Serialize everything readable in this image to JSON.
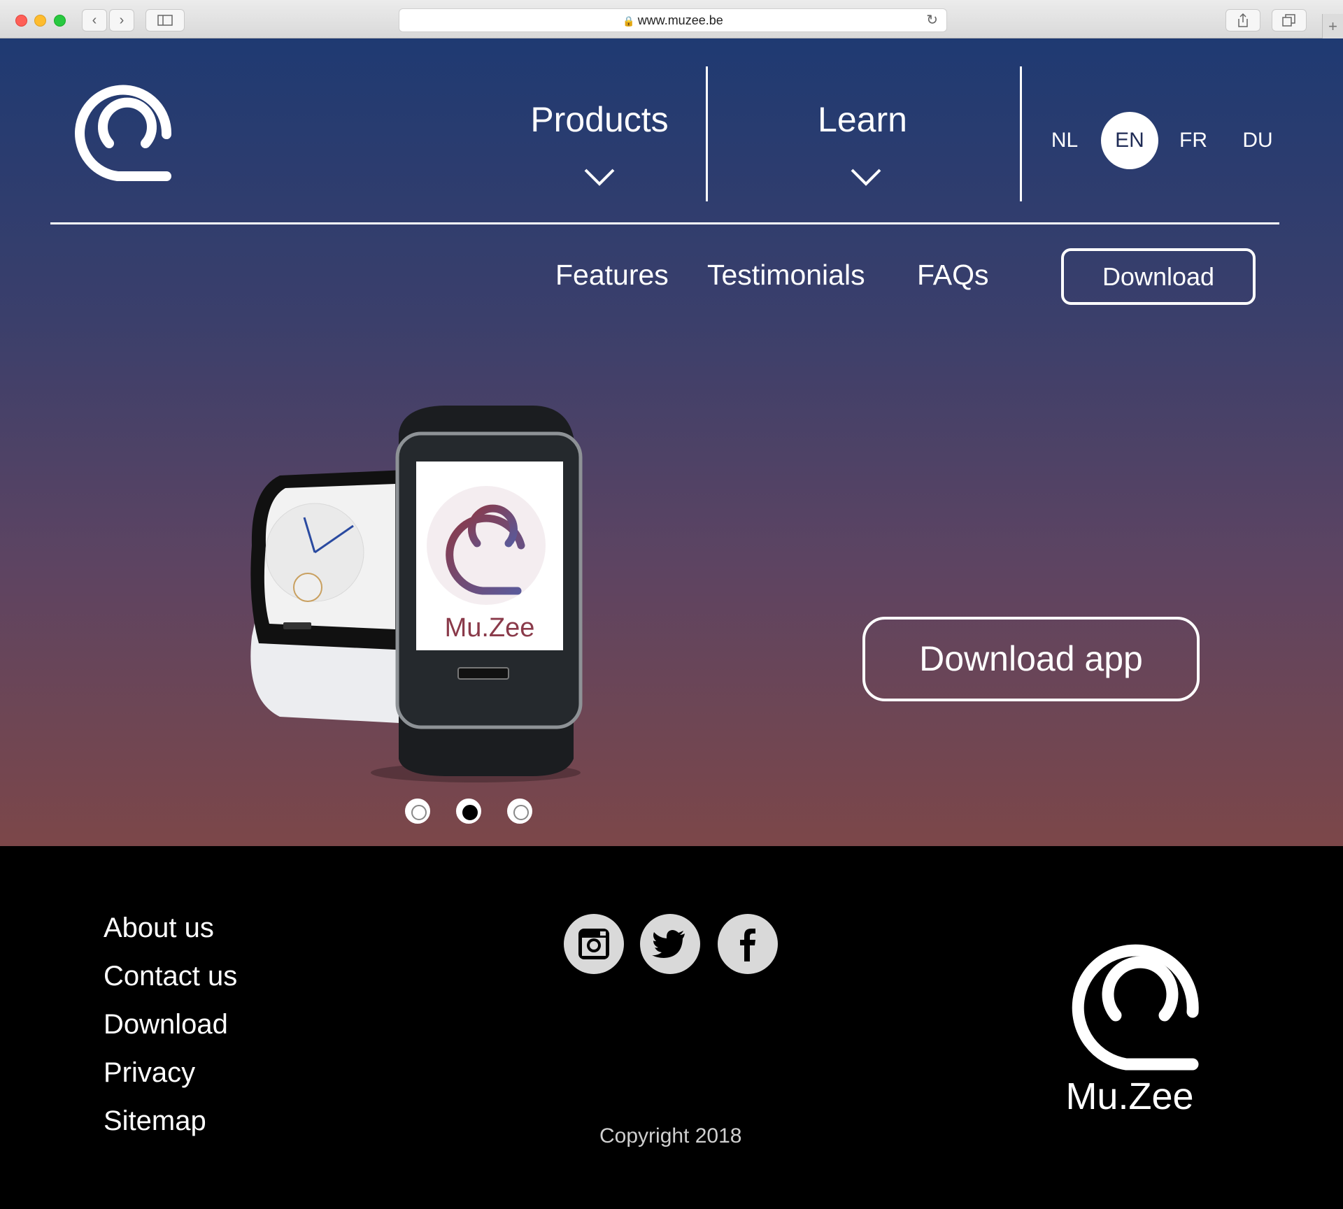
{
  "browser": {
    "url": "www.muzee.be",
    "back_icon": "chevron-left-icon",
    "forward_icon": "chevron-right-icon",
    "sidebar_icon": "sidebar-icon",
    "share_icon": "share-icon",
    "tabs_icon": "tabs-icon",
    "new_tab_label": "+"
  },
  "header": {
    "logo_icon": "muzee-logo-icon",
    "products_label": "Products",
    "learn_label": "Learn",
    "languages": [
      {
        "code": "NL",
        "active": false
      },
      {
        "code": "EN",
        "active": true
      },
      {
        "code": "FR",
        "active": false
      },
      {
        "code": "DU",
        "active": false
      }
    ]
  },
  "subnav": {
    "features": "Features",
    "testimonials": "Testimonials",
    "faqs": "FAQs",
    "download": "Download"
  },
  "hero": {
    "watch_brand": "Mu.Zee",
    "download_app": "Download app",
    "carousel": {
      "count": 3,
      "active_index": 1
    }
  },
  "footer": {
    "links": [
      "About us",
      "Contact us",
      "Download",
      "Privacy",
      "Sitemap"
    ],
    "social_icons": [
      "instagram-icon",
      "twitter-icon",
      "facebook-icon"
    ],
    "copyright": "Copyright 2018",
    "brand": "Mu.Zee"
  },
  "colors": {
    "hero_top": "#1f3a72",
    "hero_bottom": "#7c4749",
    "footer_bg": "#000000",
    "accent_white": "#ffffff"
  }
}
